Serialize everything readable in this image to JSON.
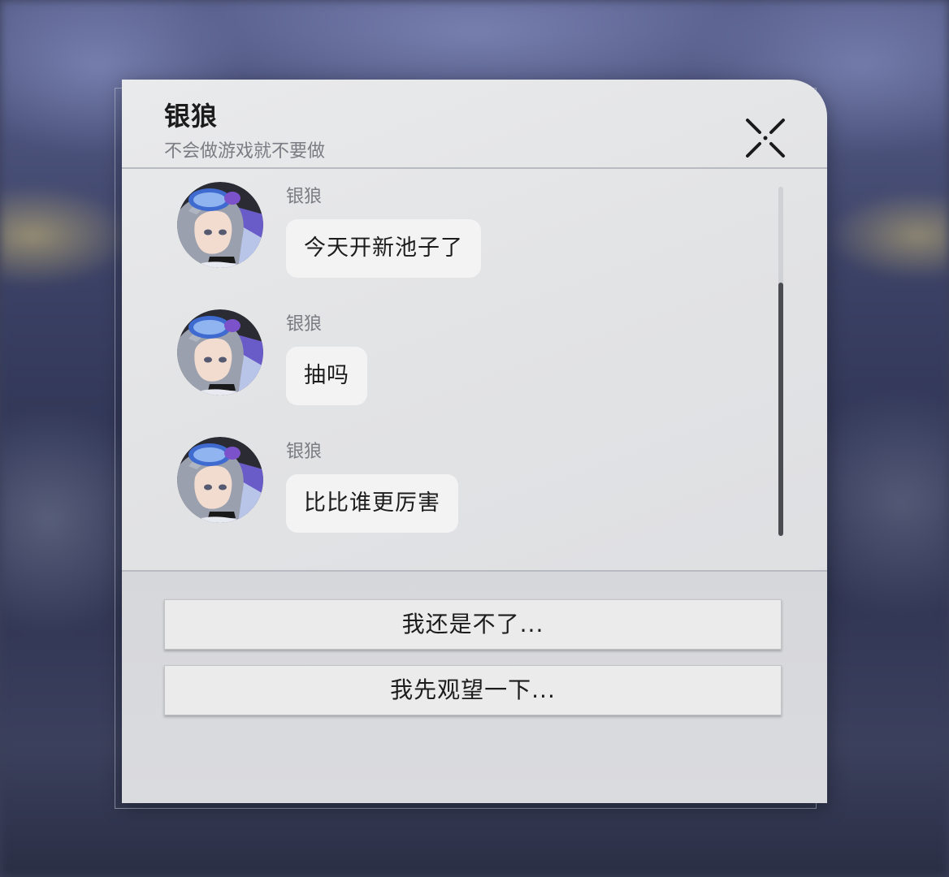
{
  "header": {
    "title": "银狼",
    "subtitle": "不会做游戏就不要做",
    "close_icon": "close-x-icon"
  },
  "messages": [
    {
      "sender": "银狼",
      "text": "今天开新池子了",
      "avatar": "silver-wolf-avatar"
    },
    {
      "sender": "银狼",
      "text": "抽吗",
      "avatar": "silver-wolf-avatar"
    },
    {
      "sender": "银狼",
      "text": "比比谁更厉害",
      "avatar": "silver-wolf-avatar"
    }
  ],
  "options": [
    {
      "label": "我还是不了..."
    },
    {
      "label": "我先观望一下..."
    }
  ],
  "colors": {
    "dialog_bg": "#e2e3e5",
    "bubble_bg": "#f3f3f4",
    "text_primary": "#1c1c1c",
    "text_secondary": "#7a7d83",
    "scroll_thumb": "#4a4c52"
  }
}
